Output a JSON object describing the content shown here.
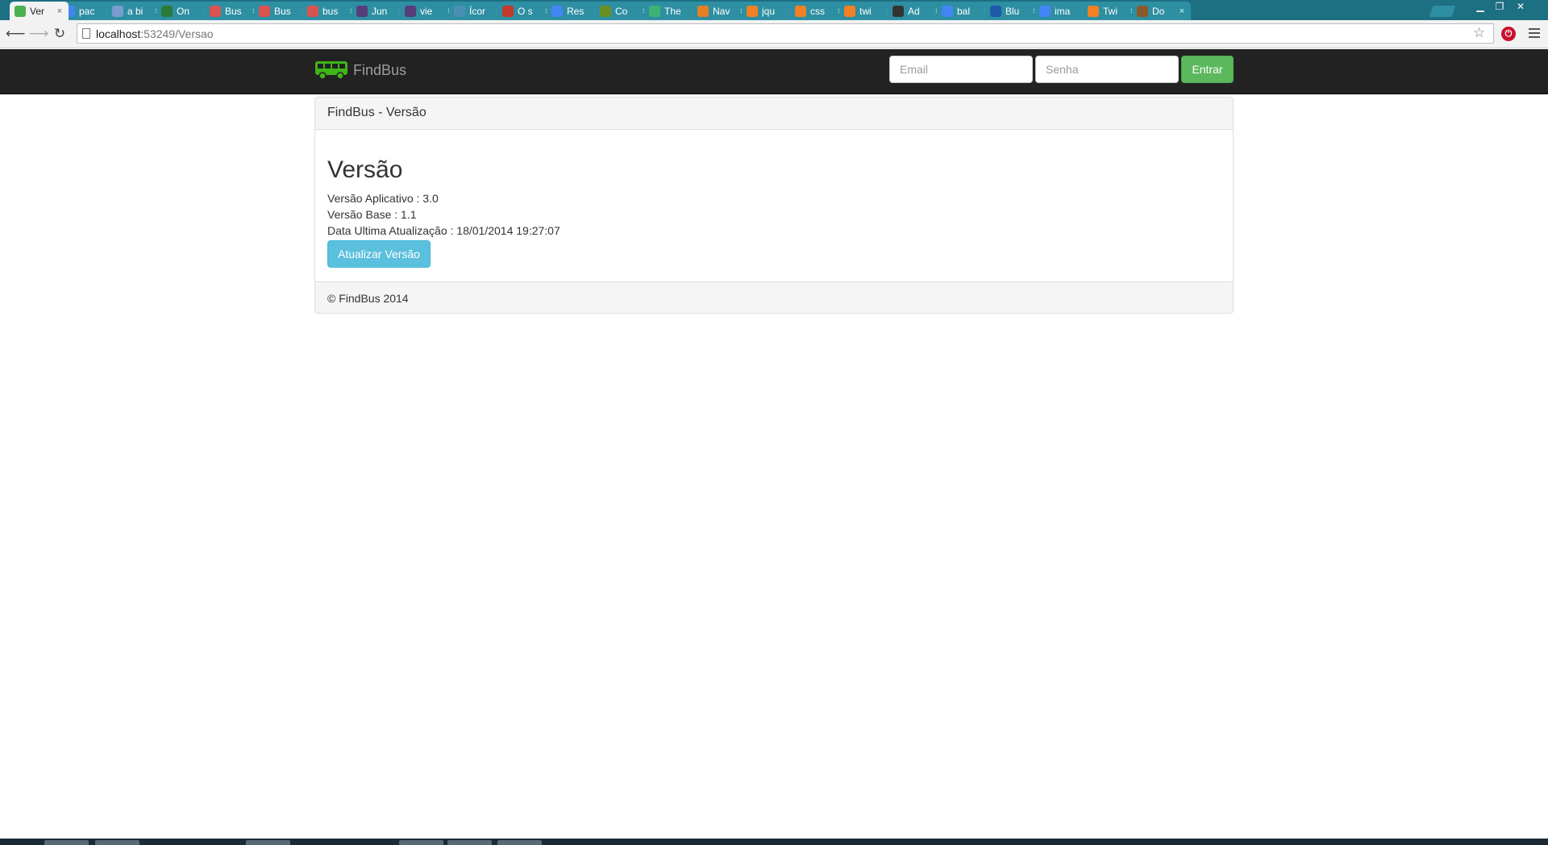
{
  "browser": {
    "tabs": [
      {
        "title": "Ver",
        "favicon_color": "#4caf50",
        "active": true
      },
      {
        "title": "pac",
        "favicon_color": "#4285f4"
      },
      {
        "title": "a bi",
        "favicon_color": "#7a9ccf"
      },
      {
        "title": "On",
        "favicon_color": "#2a7a3b"
      },
      {
        "title": "Bus",
        "favicon_color": "#d9534f"
      },
      {
        "title": "Bus",
        "favicon_color": "#d9534f"
      },
      {
        "title": "bus",
        "favicon_color": "#d9534f"
      },
      {
        "title": "Jun",
        "favicon_color": "#563d7c"
      },
      {
        "title": "vie",
        "favicon_color": "#563d7c"
      },
      {
        "title": "Ícor",
        "favicon_color": "#4a8fb5"
      },
      {
        "title": "O s",
        "favicon_color": "#c0392b"
      },
      {
        "title": "Res",
        "favicon_color": "#4285f4"
      },
      {
        "title": "Co",
        "favicon_color": "#6b8e23"
      },
      {
        "title": "The",
        "favicon_color": "#3cb371"
      },
      {
        "title": "Nav",
        "favicon_color": "#e67e22"
      },
      {
        "title": "jqu",
        "favicon_color": "#f48024"
      },
      {
        "title": "css",
        "favicon_color": "#f48024"
      },
      {
        "title": "twi",
        "favicon_color": "#f48024"
      },
      {
        "title": "Ad",
        "favicon_color": "#333333"
      },
      {
        "title": "bal",
        "favicon_color": "#4285f4"
      },
      {
        "title": "Blu",
        "favicon_color": "#1e5aa8"
      },
      {
        "title": "ima",
        "favicon_color": "#4285f4"
      },
      {
        "title": "Twi",
        "favicon_color": "#f48024"
      },
      {
        "title": "Do",
        "favicon_color": "#8b5a2b"
      }
    ],
    "url_host": "localhost",
    "url_rest": ":53249/Versao"
  },
  "nav": {
    "brand": "FindBus",
    "email_placeholder": "Email",
    "password_placeholder": "Senha",
    "login_label": "Entrar",
    "brand_color": "#3fb618"
  },
  "panel": {
    "heading": "FindBus - Versão",
    "title": "Versão",
    "lines": [
      "Versão Aplicativo : 3.0",
      "Versão Base : 1.1",
      "Data Ultima Atualização : 18/01/2014 19:27:07"
    ],
    "update_button": "Atualizar Versão",
    "footer": "© FindBus 2014"
  },
  "colors": {
    "tabstrip": "#1d6f82",
    "navbar": "#222222",
    "success": "#5cb85c",
    "info": "#5bc0de"
  }
}
